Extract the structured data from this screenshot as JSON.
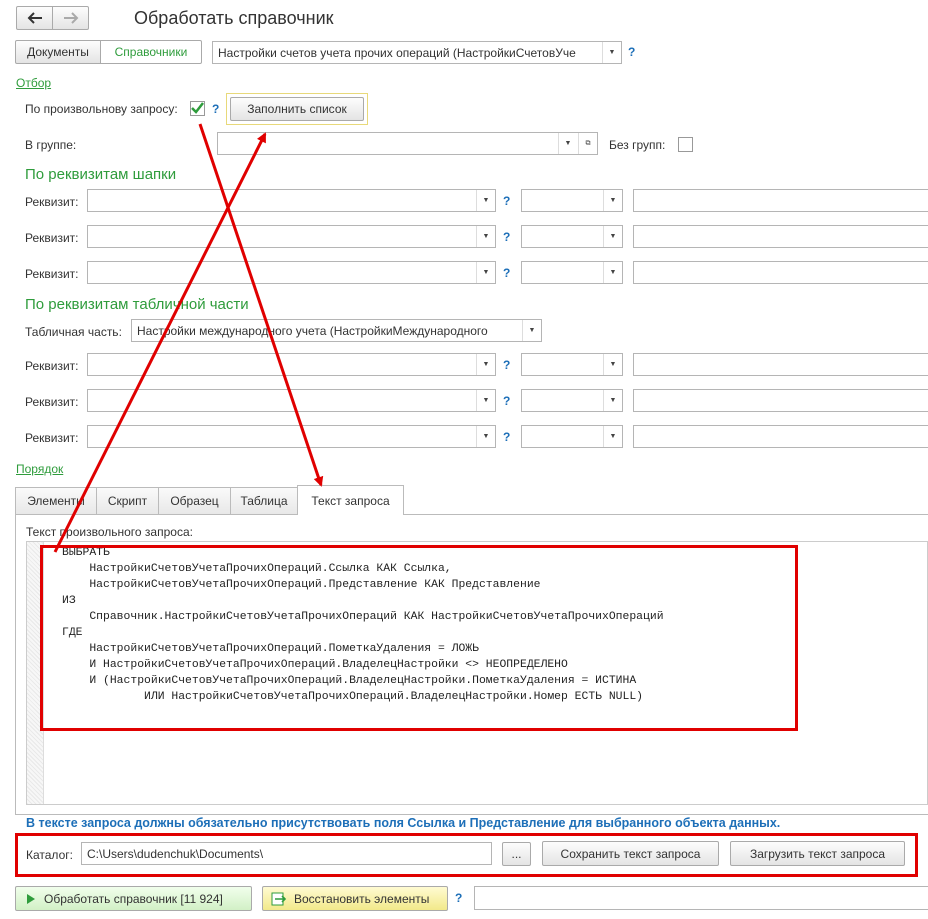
{
  "header": {
    "title": "Обработать справочник"
  },
  "top_tabs": [
    "Документы",
    "Справочники"
  ],
  "catalog_select": {
    "value": "Настройки счетов учета прочих операций (НастройкиСчетовУче"
  },
  "help": "?",
  "filter": {
    "link": "Отбор",
    "arbitrary_query_label": "По произвольнову запросу:",
    "fill_list_button": "Заполнить список",
    "in_group_label": "В группе:",
    "no_groups_label": "Без групп:"
  },
  "header_attrs": {
    "title": "По реквизитам шапки",
    "row_label": "Реквизит:"
  },
  "table_attrs": {
    "title": "По реквизитам табличной части",
    "tabular_label": "Табличная часть:",
    "tabular_value": "Настройки международного учета (НастройкиМеждународного"
  },
  "order_link": "Порядок",
  "bottom_tabs": [
    "Элементы",
    "Скрипт",
    "Образец",
    "Таблица",
    "Текст запроса"
  ],
  "query": {
    "label": "Текст произвольного запроса:",
    "lines": [
      "ВЫБРАТЬ",
      "    НастройкиСчетовУчетаПрочихОпераций.Ссылка КАК Ссылка,",
      "    НастройкиСчетовУчетаПрочихОпераций.Представление КАК Представление",
      "ИЗ",
      "    Справочник.НастройкиСчетовУчетаПрочихОпераций КАК НастройкиСчетовУчетаПрочихОпераций",
      "ГДЕ",
      "    НастройкиСчетовУчетаПрочихОпераций.ПометкаУдаления = ЛОЖЬ",
      "    И НастройкиСчетовУчетаПрочихОпераций.ВладелецНастройки <> НЕОПРЕДЕЛЕНО",
      "    И (НастройкиСчетовУчетаПрочихОпераций.ВладелецНастройки.ПометкаУдаления = ИСТИНА",
      "            ИЛИ НастройкиСчетовУчетаПрочихОпераций.ВладелецНастройки.Номер ЕСТЬ NULL)"
    ],
    "warning": "В тексте запроса должны обязательно присутствовать поля Ссылка и Представление для выбранного объекта данных."
  },
  "catalog_path": {
    "label": "Каталог:",
    "value": "C:\\Users\\dudenchuk\\Documents\\",
    "browse": "...",
    "save": "Сохранить текст запроса",
    "load": "Загрузить текст запроса"
  },
  "footer": {
    "process": "Обработать справочник [11 924]",
    "restore": "Восстановить элементы"
  },
  "colors": {
    "accent_green": "#2f9c3c",
    "annotation_red": "#e00000",
    "warning_blue": "#1d6fb8"
  }
}
